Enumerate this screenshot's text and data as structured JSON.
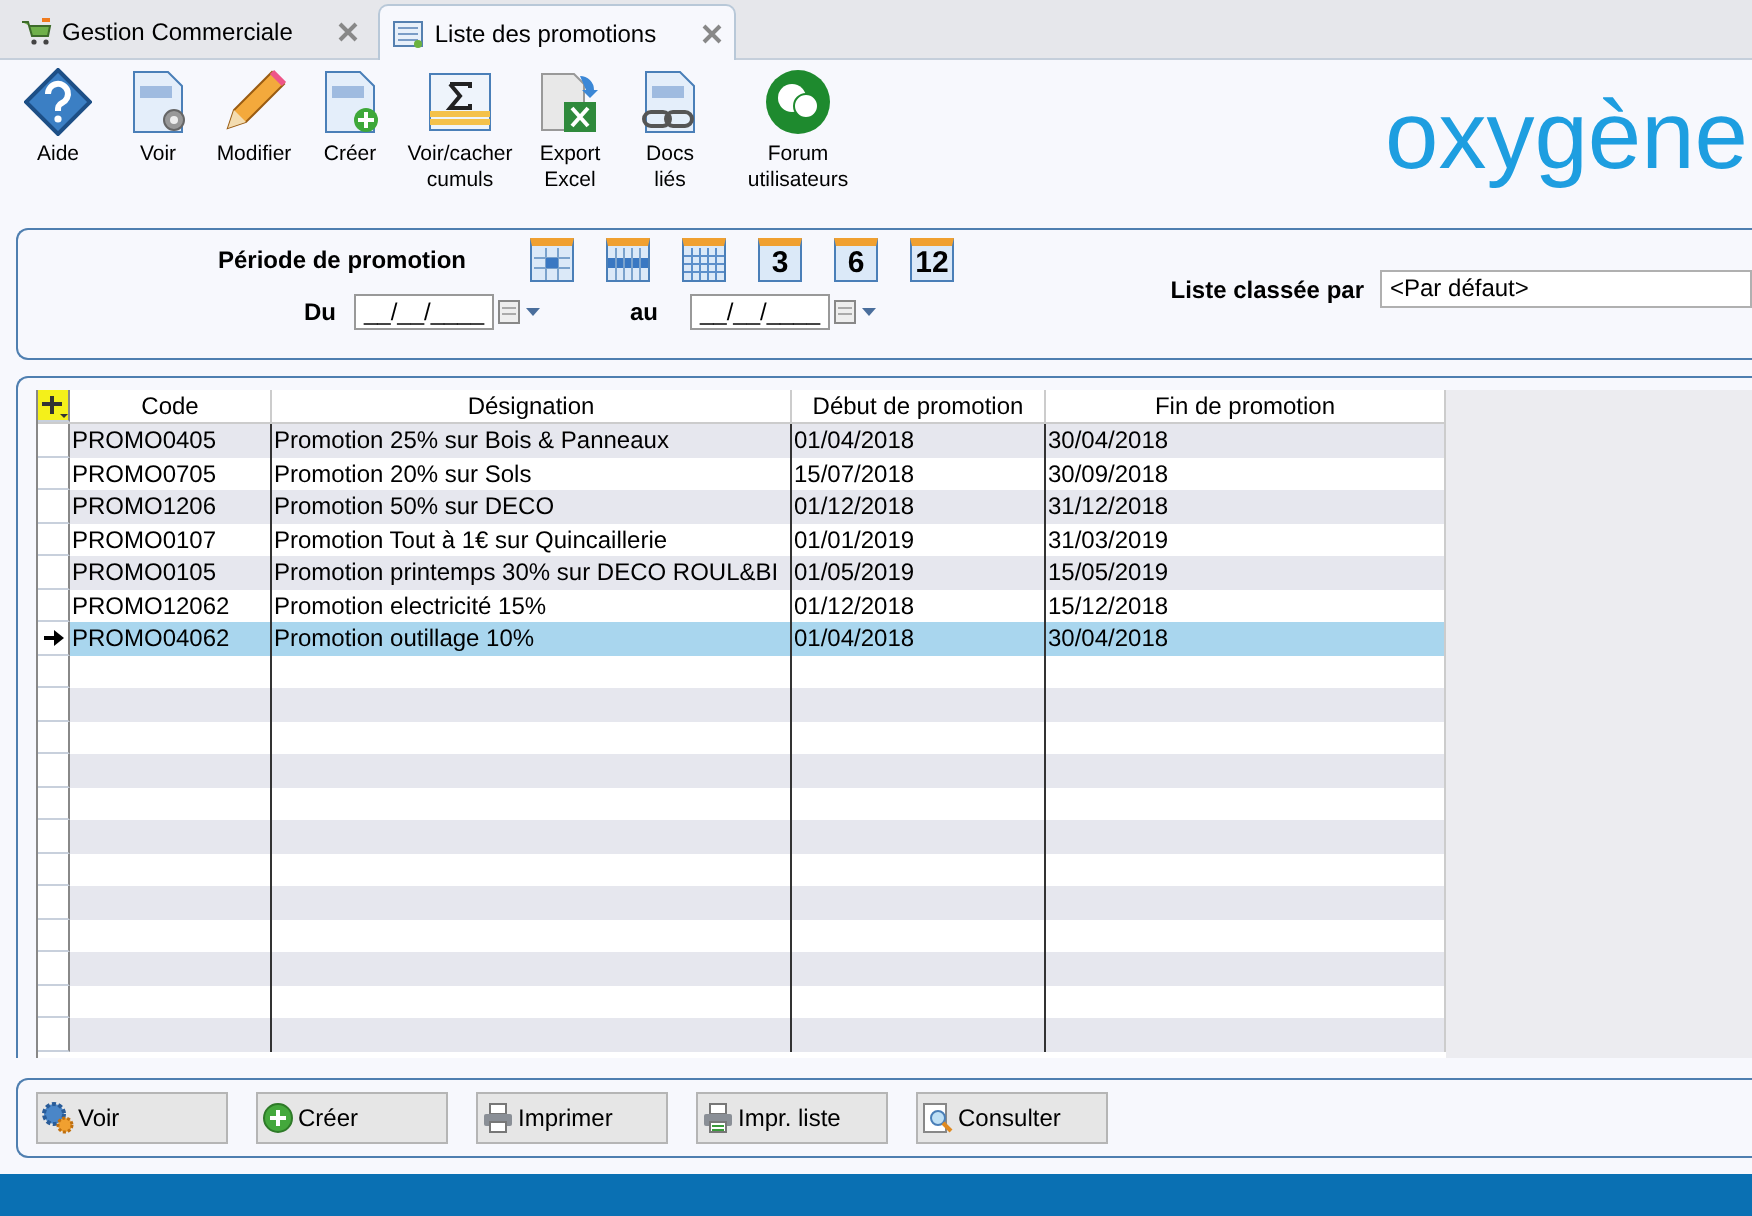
{
  "tabs": [
    {
      "label": "Gestion Commerciale",
      "selected": false,
      "kind": "cart"
    },
    {
      "label": "Liste des promotions",
      "selected": true,
      "kind": "list"
    }
  ],
  "toolbar": [
    {
      "label": "Aide",
      "kind": "help"
    },
    {
      "label": "Voir",
      "kind": "view"
    },
    {
      "label": "Modifier",
      "kind": "edit"
    },
    {
      "label": "Créer",
      "kind": "create"
    },
    {
      "label": "Voir/cacher cumuls",
      "kind": "sum"
    },
    {
      "label": "Export Excel",
      "kind": "excel"
    },
    {
      "label": "Docs liés",
      "kind": "link"
    },
    {
      "label": "Forum utilisateurs",
      "kind": "forum"
    }
  ],
  "logo": "oxygène",
  "filter": {
    "period_label": "Période de promotion",
    "period_buttons": [
      {
        "kind": "day"
      },
      {
        "kind": "week"
      },
      {
        "kind": "month"
      },
      {
        "kind": "number",
        "label": "3"
      },
      {
        "kind": "number",
        "label": "6"
      },
      {
        "kind": "number",
        "label": "12"
      }
    ],
    "from_label": "Du",
    "from_value": "__/__/____",
    "to_label": "au",
    "to_value": "__/__/____",
    "sort_label": "Liste classée par",
    "sort_value": "<Par défaut>"
  },
  "table": {
    "columns": [
      "Code",
      "Désignation",
      "Début de promotion",
      "Fin de promotion"
    ],
    "rows": [
      {
        "cells": [
          "PROMO0405",
          "Promotion 25% sur Bois & Panneaux",
          "01/04/2018",
          "30/04/2018"
        ],
        "selected": false
      },
      {
        "cells": [
          "PROMO0705",
          "Promotion 20% sur Sols",
          "15/07/2018",
          "30/09/2018"
        ],
        "selected": false
      },
      {
        "cells": [
          "PROMO1206",
          "Promotion 50% sur DECO",
          "01/12/2018",
          "31/12/2018"
        ],
        "selected": false
      },
      {
        "cells": [
          "PROMO0107",
          "Promotion Tout à 1€ sur Quincaillerie",
          "01/01/2019",
          "31/03/2019"
        ],
        "selected": false
      },
      {
        "cells": [
          "PROMO0105",
          "Promotion printemps 30% sur DECO ROUL&BI",
          "01/05/2019",
          "15/05/2019"
        ],
        "selected": false
      },
      {
        "cells": [
          "PROMO12062",
          "Promotion electricité 15%",
          "01/12/2018",
          "15/12/2018"
        ],
        "selected": false
      },
      {
        "cells": [
          "PROMO04062",
          "Promotion outillage 10%",
          "01/04/2018",
          "30/04/2018"
        ],
        "selected": true
      }
    ]
  },
  "buttons": [
    {
      "label": "Voir",
      "kind": "gear"
    },
    {
      "label": "Créer",
      "kind": "plus"
    },
    {
      "label": "Imprimer",
      "kind": "print"
    },
    {
      "label": "Impr. liste",
      "kind": "printlist"
    },
    {
      "label": "Consulter",
      "kind": "search"
    }
  ]
}
